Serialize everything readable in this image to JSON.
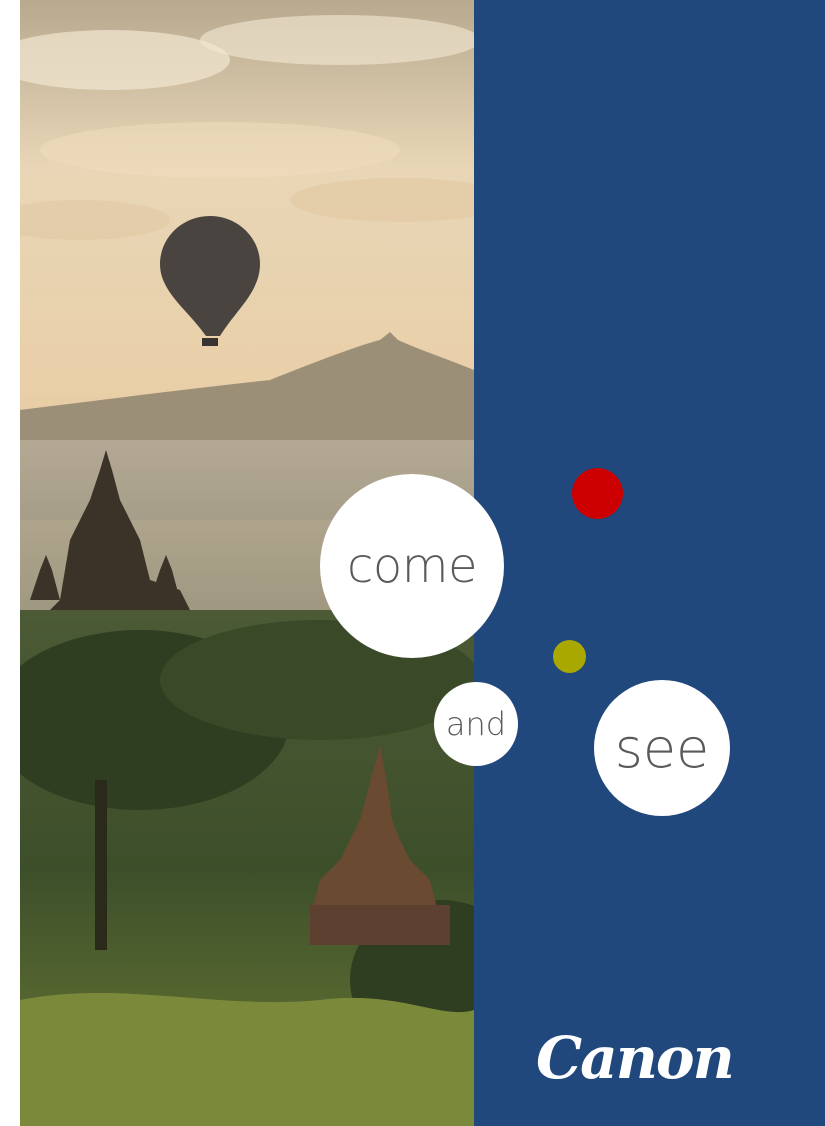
{
  "words": {
    "come": "come",
    "and": "and",
    "see": "see"
  },
  "brand": {
    "logo_text": "Canon"
  },
  "colors": {
    "panel_blue": "#21487d",
    "dot_red": "#cc0000",
    "dot_olive": "#a8a800"
  }
}
